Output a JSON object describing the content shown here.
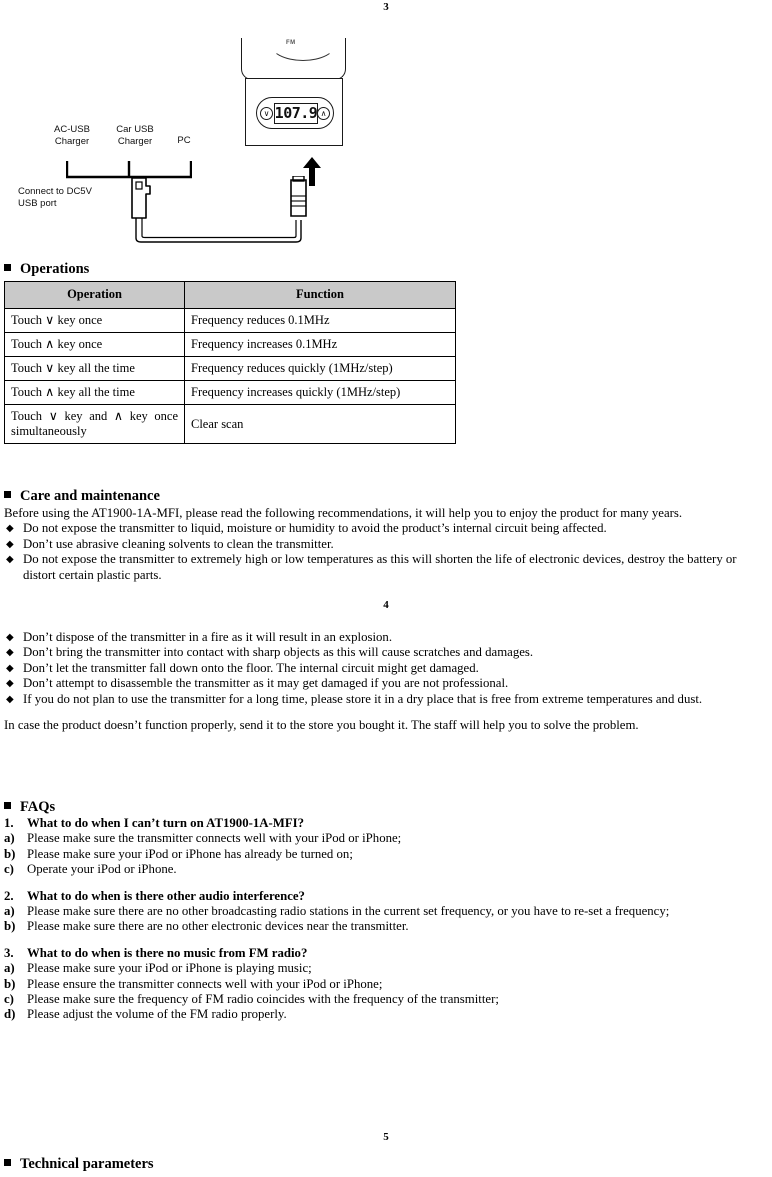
{
  "pages": {
    "first": "3",
    "second": "4",
    "third": "5"
  },
  "figure": {
    "device": {
      "fm_label": "FM",
      "lcd_value": "107.9",
      "button_down_icon": "chevron-down-circle-icon",
      "button_down_glyph": "∨",
      "button_up_icon": "chevron-up-circle-icon",
      "button_up_glyph": "∧"
    },
    "source_labels": [
      {
        "line1": "AC-USB",
        "line2": "Charger"
      },
      {
        "line1": "Car USB",
        "line2": "Charger"
      },
      {
        "line1": "PC",
        "line2": ""
      }
    ],
    "connect_label_line1": "Connect to  DC5V",
    "connect_label_line2": "USB port",
    "arrow_icon": "up-arrow-icon",
    "cable_icon": "usb-cable-icon"
  },
  "operations": {
    "heading": "Operations",
    "columns": [
      "Operation",
      "Function"
    ],
    "rows": [
      {
        "operation": "Touch ∨ key once",
        "function": "Frequency reduces 0.1MHz"
      },
      {
        "operation": "Touch ∧ key once",
        "function": "Frequency increases 0.1MHz"
      },
      {
        "operation": "Touch ∨ key all the time",
        "function": "Frequency reduces quickly (1MHz/step)"
      },
      {
        "operation": "Touch ∧ key all the time",
        "function": "Frequency increases quickly (1MHz/step)"
      },
      {
        "operation": "Touch ∨ key and ∧ key once simultaneously",
        "function": "Clear scan"
      }
    ]
  },
  "care": {
    "heading": "Care and maintenance",
    "intro": "Before using the AT1900-1A-MFI, please read the following recommendations, it will help you to enjoy the product for many years.",
    "bullets_page4_top": [
      "Do not expose the transmitter to liquid, moisture or humidity to avoid the product’s internal circuit being affected.",
      "Don’t use abrasive cleaning solvents to clean the transmitter.",
      "Do not expose the transmitter to extremely high or low temperatures as this will shorten the life of electronic devices, destroy the battery or distort certain plastic parts."
    ],
    "bullets_page4_bottom": [
      "Don’t dispose of the transmitter in a fire as it will result in an explosion.",
      "Don’t bring the transmitter into contact with sharp objects as this will cause scratches and damages.",
      "Don’t let the transmitter fall down onto the floor. The internal circuit might get damaged.",
      "Don’t attempt to disassemble the transmitter as it may get damaged if you are not professional.",
      "If you do not plan to use the transmitter for a long time, please store it in a dry place that is free from extreme temperatures and dust."
    ],
    "closing": "In case the product doesn’t function properly, send it to the store you bought it. The staff will help you to solve the problem.",
    "bullet_glyph": "◆"
  },
  "faqs": {
    "heading": "FAQs",
    "items": [
      {
        "num": "1.",
        "question": "What to do when I can’t turn on AT1900-1A-MFI?",
        "answers": [
          {
            "letter": "a)",
            "text": "Please make sure the transmitter connects well with your iPod or iPhone;"
          },
          {
            "letter": "b)",
            "text": "Please make sure your iPod or iPhone has already be turned on;"
          },
          {
            "letter": "c)",
            "text": "Operate your iPod or iPhone."
          }
        ]
      },
      {
        "num": "2.",
        "question": "What to do when is there other audio interference?",
        "answers": [
          {
            "letter": "a)",
            "text": "Please make sure there are no other broadcasting radio stations in the current set frequency, or you have to re-set a frequency;"
          },
          {
            "letter": "b)",
            "text": "Please make sure there are no other electronic devices near the transmitter."
          }
        ]
      },
      {
        "num": "3.",
        "question": "What to do when is there no music from FM radio?",
        "answers": [
          {
            "letter": "a)",
            "text": "Please make sure your iPod or iPhone is playing music;"
          },
          {
            "letter": "b)",
            "text": "Please ensure the transmitter connects well with your iPod or iPhone;"
          },
          {
            "letter": "c)",
            "text": "Please make sure the frequency of FM radio coincides with the frequency of the transmitter;"
          },
          {
            "letter": "d)",
            "text": "Please adjust the volume of the FM radio properly."
          }
        ]
      }
    ]
  },
  "technical": {
    "heading": "Technical parameters"
  },
  "colors": {
    "table_header_bg": "#c9c9c9",
    "ink": "#000000",
    "page_bg": "#ffffff"
  }
}
